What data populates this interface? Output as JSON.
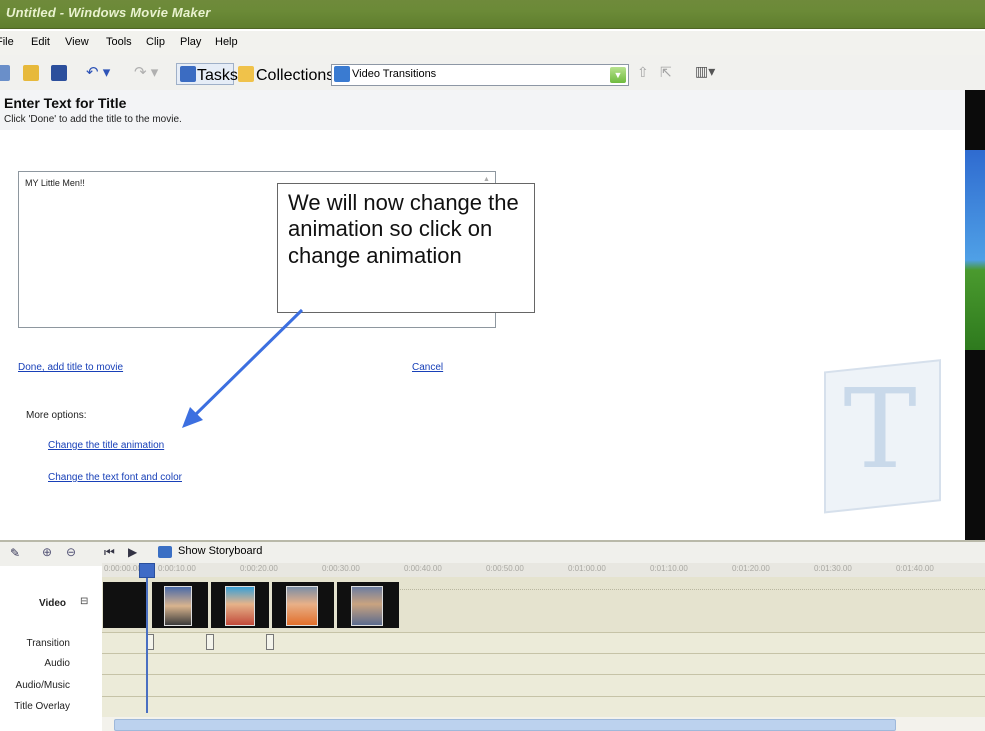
{
  "window": {
    "title": "Untitled - Windows Movie Maker"
  },
  "menu": [
    "File",
    "Edit",
    "View",
    "Tools",
    "Clip",
    "Play",
    "Help"
  ],
  "toolbar": {
    "tasks_label": "Tasks",
    "collections_label": "Collections",
    "combo_value": "Video Transitions"
  },
  "pane": {
    "title": "Enter Text for Title",
    "subtitle": "Click 'Done' to add the title to the movie.",
    "textarea_value": "MY Little Men!!",
    "done_link": "Done, add title to movie",
    "cancel_link": "Cancel",
    "more_options": "More options:",
    "animation_link": "Change the title animation",
    "font_link": "Change the text font and color"
  },
  "callout": {
    "text": "We will now change the animation so click on change animation"
  },
  "timeline": {
    "show_storyboard": "Show Storyboard",
    "tracks": [
      "Video",
      "Transition",
      "Audio",
      "Audio/Music",
      "Title Overlay"
    ],
    "ruler": [
      "0:00:00.00",
      "0:00:10.00",
      "0:00:20.00",
      "0:00:30.00",
      "0:00:40.00",
      "0:00:50.00",
      "0:01:00.00",
      "0:01:10.00",
      "0:01:20.00",
      "0:01:30.00",
      "0:01:40.00"
    ]
  },
  "colors": {
    "titlebar": "#6b8a37",
    "link": "#1840b8",
    "timeline_bg": "#ecebd9",
    "arrow": "#3c6fe0"
  }
}
